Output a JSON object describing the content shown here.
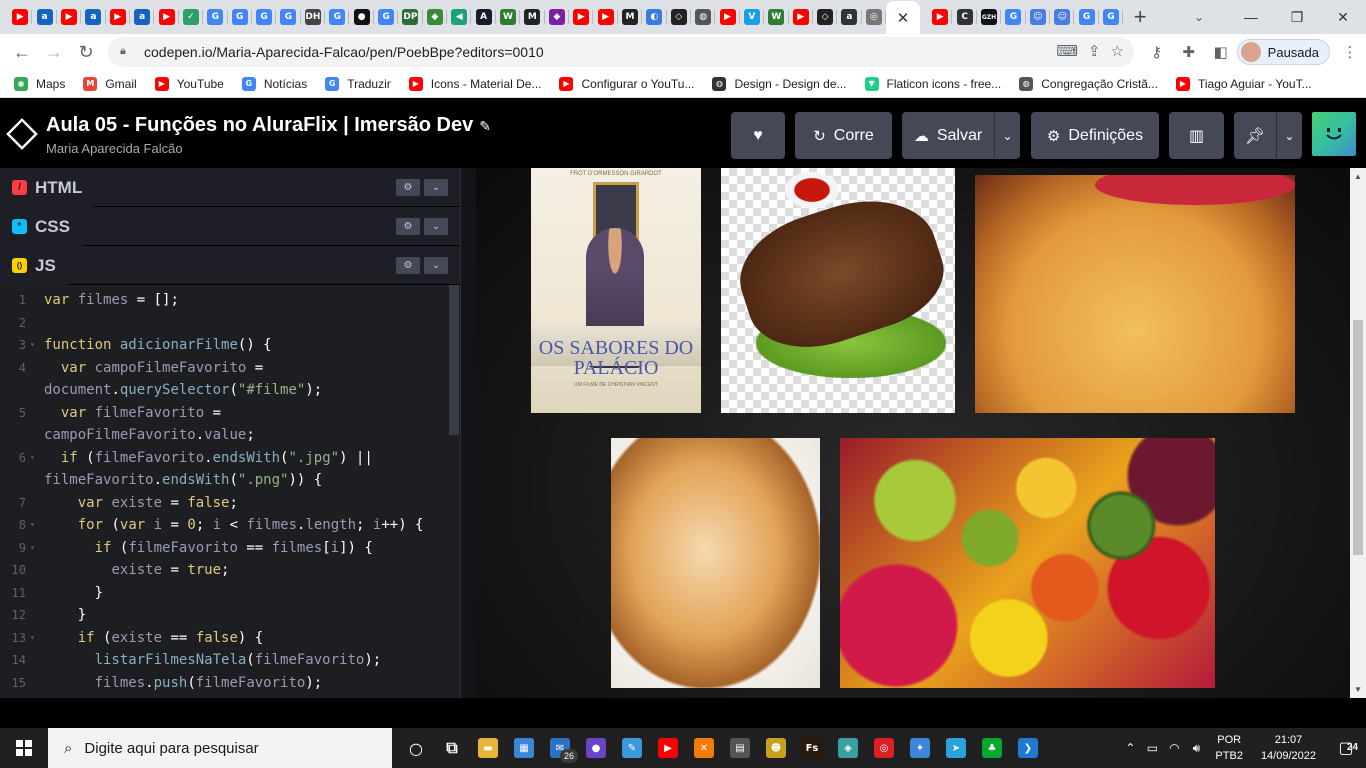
{
  "browser": {
    "tab_favicons": [
      {
        "icon": "youtube-icon",
        "color": "#ff0000",
        "glyph": "▶"
      },
      {
        "icon": "alura-icon",
        "color": "#1565c0",
        "glyph": "a"
      },
      {
        "icon": "youtube-icon",
        "color": "#ff0000",
        "glyph": "▶"
      },
      {
        "icon": "alura-icon",
        "color": "#1565c0",
        "glyph": "a"
      },
      {
        "icon": "youtube-icon",
        "color": "#ff0000",
        "glyph": "▶"
      },
      {
        "icon": "alura-icon",
        "color": "#1565c0",
        "glyph": "a"
      },
      {
        "icon": "youtube-icon",
        "color": "#ff0000",
        "glyph": "▶"
      },
      {
        "icon": "check-icon",
        "color": "#2e9e6b",
        "glyph": "✓"
      },
      {
        "icon": "google-icon",
        "color": "#4285f4",
        "glyph": "G"
      },
      {
        "icon": "google-icon",
        "color": "#4285f4",
        "glyph": "G"
      },
      {
        "icon": "google-icon",
        "color": "#4285f4",
        "glyph": "G"
      },
      {
        "icon": "google-icon",
        "color": "#4285f4",
        "glyph": "G"
      },
      {
        "icon": "dh-icon",
        "color": "#444444",
        "glyph": "DH"
      },
      {
        "icon": "google-icon",
        "color": "#4285f4",
        "glyph": "G"
      },
      {
        "icon": "github-icon",
        "color": "#111111",
        "glyph": "●"
      },
      {
        "icon": "google-icon",
        "color": "#4285f4",
        "glyph": "G"
      },
      {
        "icon": "dp-icon",
        "color": "#2d6b3a",
        "glyph": "DP"
      },
      {
        "icon": "green-icon",
        "color": "#3a8a3a",
        "glyph": "◆"
      },
      {
        "icon": "teal-icon",
        "color": "#1aa37a",
        "glyph": "◀"
      },
      {
        "icon": "a-icon",
        "color": "#1a1a2e",
        "glyph": "A"
      },
      {
        "icon": "w-icon",
        "color": "#2e7d32",
        "glyph": "W"
      },
      {
        "icon": "m-icon",
        "color": "#222222",
        "glyph": "M"
      },
      {
        "icon": "purple-icon",
        "color": "#7b1fa2",
        "glyph": "◆"
      },
      {
        "icon": "youtube-icon",
        "color": "#ff0000",
        "glyph": "▶"
      },
      {
        "icon": "youtube-icon",
        "color": "#ff0000",
        "glyph": "▶"
      },
      {
        "icon": "m-icon",
        "color": "#222222",
        "glyph": "M"
      },
      {
        "icon": "blue-circle-icon",
        "color": "#3b7be0",
        "glyph": "◐"
      },
      {
        "icon": "codepen-icon",
        "color": "#222222",
        "glyph": "◇"
      },
      {
        "icon": "globe-icon",
        "color": "#555555",
        "glyph": "◍"
      },
      {
        "icon": "youtube-icon",
        "color": "#ff0000",
        "glyph": "▶"
      },
      {
        "icon": "v-icon",
        "color": "#1aa0e0",
        "glyph": "V"
      },
      {
        "icon": "w-icon",
        "color": "#2e7d32",
        "glyph": "W"
      },
      {
        "icon": "youtube-icon",
        "color": "#ff0000",
        "glyph": "▶"
      },
      {
        "icon": "codepen-icon",
        "color": "#222222",
        "glyph": "◇"
      },
      {
        "icon": "alura-icon",
        "color": "#333333",
        "glyph": "a"
      },
      {
        "icon": "chrome-icon",
        "color": "#777777",
        "glyph": "◎"
      }
    ],
    "tab_favicons_after": [
      {
        "icon": "youtube-icon",
        "color": "#ff0000",
        "glyph": "▶"
      },
      {
        "icon": "c-icon",
        "color": "#333333",
        "glyph": "C"
      },
      {
        "icon": "gzh-icon",
        "color": "#111111",
        "glyph": "GZH"
      },
      {
        "icon": "google-icon",
        "color": "#4285f4",
        "glyph": "G"
      },
      {
        "icon": "robot-icon",
        "color": "#4a7de0",
        "glyph": "☺"
      },
      {
        "icon": "robot-icon",
        "color": "#4a7de0",
        "glyph": "☺"
      },
      {
        "icon": "google-icon",
        "color": "#4285f4",
        "glyph": "G"
      },
      {
        "icon": "google-icon",
        "color": "#4285f4",
        "glyph": "G"
      }
    ],
    "url": "codepen.io/Maria-Aparecida-Falcao/pen/PoebBpe?editors=0010",
    "profile_label": "Pausada",
    "bookmarks": [
      {
        "label": "Maps",
        "icon": "maps-icon",
        "color": "#34a853",
        "glyph": "◉"
      },
      {
        "label": "Gmail",
        "icon": "gmail-icon",
        "color": "#ea4335",
        "glyph": "M"
      },
      {
        "label": "YouTube",
        "icon": "youtube-icon",
        "color": "#ff0000",
        "glyph": "▶"
      },
      {
        "label": "Notícias",
        "icon": "news-icon",
        "color": "#4285f4",
        "glyph": "G"
      },
      {
        "label": "Traduzir",
        "icon": "translate-icon",
        "color": "#4285f4",
        "glyph": "G"
      },
      {
        "label": "Icons - Material De...",
        "icon": "youtube-icon",
        "color": "#ff0000",
        "glyph": "▶"
      },
      {
        "label": "Configurar o YouTu...",
        "icon": "youtube-icon",
        "color": "#ff0000",
        "glyph": "▶"
      },
      {
        "label": "Design - Design de...",
        "icon": "globe-icon",
        "color": "#333333",
        "glyph": "◍"
      },
      {
        "label": "Flaticon icons - free...",
        "icon": "flaticon-icon",
        "color": "#1fcf8a",
        "glyph": "▼"
      },
      {
        "label": "Congregação Cristã...",
        "icon": "globe-icon",
        "color": "#555555",
        "glyph": "◍"
      },
      {
        "label": "Tiago Aguiar - YouT...",
        "icon": "youtube-icon",
        "color": "#ff0000",
        "glyph": "▶"
      }
    ]
  },
  "codepen": {
    "title": "Aula 05 - Funções no AluraFlix | Imersão Dev",
    "author": "Maria Aparecida Falcão",
    "run_label": "Corre",
    "save_label": "Salvar",
    "settings_label": "Definições"
  },
  "panes": [
    {
      "label": "HTML",
      "color": "#ff3c41",
      "glyph": "/"
    },
    {
      "label": "CSS",
      "color": "#0ebeff",
      "glyph": "*"
    },
    {
      "label": "JS",
      "color": "#fcd000",
      "glyph": "()"
    }
  ],
  "code_lines": [
    {
      "n": "1",
      "fold": false,
      "html": "<span class='k'>var</span> <span class='v'>filmes</span> <span class='p'>= [];</span>"
    },
    {
      "n": "2",
      "fold": false,
      "html": ""
    },
    {
      "n": "3",
      "fold": true,
      "html": "<span class='k'>function</span> <span class='f'>adicionarFilme</span><span class='p'>() {</span>"
    },
    {
      "n": "4",
      "fold": false,
      "html": "  <span class='k'>var</span> <span class='v'>campoFilmeFavorito</span> <span class='p'>=</span>"
    },
    {
      "n": "",
      "fold": false,
      "html": "<span class='v'>document</span><span class='p'>.</span><span class='f'>querySelector</span><span class='p'>(</span><span class='s'>\"#filme\"</span><span class='p'>);</span>"
    },
    {
      "n": "5",
      "fold": false,
      "html": "  <span class='k'>var</span> <span class='v'>filmeFavorito</span> <span class='p'>=</span>"
    },
    {
      "n": "",
      "fold": false,
      "html": "<span class='v'>campoFilmeFavorito</span><span class='p'>.</span><span class='v'>value</span><span class='p'>;</span>"
    },
    {
      "n": "6",
      "fold": true,
      "html": "  <span class='k'>if</span> <span class='p'>(</span><span class='v'>filmeFavorito</span><span class='p'>.</span><span class='f'>endsWith</span><span class='p'>(</span><span class='s'>\".jpg\"</span><span class='p'>) ||</span>"
    },
    {
      "n": "",
      "fold": false,
      "html": "<span class='v'>filmeFavorito</span><span class='p'>.</span><span class='f'>endsWith</span><span class='p'>(</span><span class='s'>\".png\"</span><span class='p'>)) {</span>"
    },
    {
      "n": "7",
      "fold": false,
      "html": "    <span class='k'>var</span> <span class='v'>existe</span> <span class='p'>=</span> <span class='k'>false</span><span class='p'>;</span>"
    },
    {
      "n": "8",
      "fold": true,
      "html": "    <span class='k'>for</span> <span class='p'>(</span><span class='k'>var</span> <span class='v'>i</span> <span class='p'>=</span> <span class='k'>0</span><span class='p'>;</span> <span class='v'>i</span> <span class='p'>&lt;</span> <span class='v'>filmes</span><span class='p'>.</span><span class='v'>length</span><span class='p'>;</span> <span class='v'>i</span><span class='p'>++) {</span>"
    },
    {
      "n": "9",
      "fold": true,
      "html": "      <span class='k'>if</span> <span class='p'>(</span><span class='v'>filmeFavorito</span> <span class='p'>==</span> <span class='v'>filmes</span><span class='p'>[</span><span class='v'>i</span><span class='p'>]) {</span>"
    },
    {
      "n": "10",
      "fold": false,
      "html": "        <span class='v'>existe</span> <span class='p'>=</span> <span class='k'>true</span><span class='p'>;</span>"
    },
    {
      "n": "11",
      "fold": false,
      "html": "      <span class='p'>}</span>"
    },
    {
      "n": "12",
      "fold": false,
      "html": "    <span class='p'>}</span>"
    },
    {
      "n": "13",
      "fold": true,
      "html": "    <span class='k'>if</span> <span class='p'>(</span><span class='v'>existe</span> <span class='p'>==</span> <span class='k'>false</span><span class='p'>) {</span>"
    },
    {
      "n": "14",
      "fold": false,
      "html": "      <span class='f'>listarFilmesNaTela</span><span class='p'>(</span><span class='v'>filmeFavorito</span><span class='p'>);</span>"
    },
    {
      "n": "15",
      "fold": false,
      "html": "      <span class='v'>filmes</span><span class='p'>.</span><span class='f'>push</span><span class='p'>(</span><span class='v'>filmeFavorito</span><span class='p'>);</span>"
    }
  ],
  "preview": {
    "poster_title": "OS SABORES DO PALÁCIO",
    "poster_cast": "FROT    D'ORMESSON    GIRARDOT",
    "poster_credit": "UM FILME DE CHRISTIAN VINCENT"
  },
  "taskbar": {
    "search_placeholder": "Digite aqui para pesquisar",
    "apps": [
      {
        "icon": "cortana-icon",
        "color": "#202020",
        "glyph": "○"
      },
      {
        "icon": "task-view-icon",
        "color": "#202020",
        "glyph": "⧉"
      },
      {
        "icon": "file-explorer-icon",
        "color": "#e8b63a",
        "glyph": "▬"
      },
      {
        "icon": "store-icon",
        "color": "#3a86d9",
        "glyph": "▦"
      },
      {
        "icon": "mail-icon",
        "color": "#2a72c4",
        "glyph": "✉"
      },
      {
        "icon": "github-desktop-icon",
        "color": "#6b42c8",
        "glyph": "●"
      },
      {
        "icon": "paint-icon",
        "color": "#3a9ad9",
        "glyph": "✎"
      },
      {
        "icon": "youtube-icon",
        "color": "#ff0000",
        "glyph": "▶"
      },
      {
        "icon": "xampp-icon",
        "color": "#f57c00",
        "glyph": "✕"
      },
      {
        "icon": "calculator-icon",
        "color": "#555555",
        "glyph": "▤"
      },
      {
        "icon": "pet-icon",
        "color": "#c8a020",
        "glyph": "☻"
      },
      {
        "icon": "fs-icon",
        "color": "#2b1a0a",
        "glyph": "Fs"
      },
      {
        "icon": "cube-icon",
        "color": "#3aa0a0",
        "glyph": "◈"
      },
      {
        "icon": "creative-cloud-icon",
        "color": "#da1f26",
        "glyph": "◎"
      },
      {
        "icon": "network-icon",
        "color": "#3a86d9",
        "glyph": "✦"
      },
      {
        "icon": "telegram-icon",
        "color": "#2aa3dd",
        "glyph": "➤"
      },
      {
        "icon": "evernote-icon",
        "color": "#00a82d",
        "glyph": "♣"
      },
      {
        "icon": "vscode-icon",
        "color": "#1f7ad1",
        "glyph": "❯"
      }
    ],
    "mail_badge": "26",
    "lang_line1": "POR",
    "lang_line2": "PTB2",
    "time": "21:07",
    "date": "14/09/2022",
    "notif_count": "24"
  }
}
